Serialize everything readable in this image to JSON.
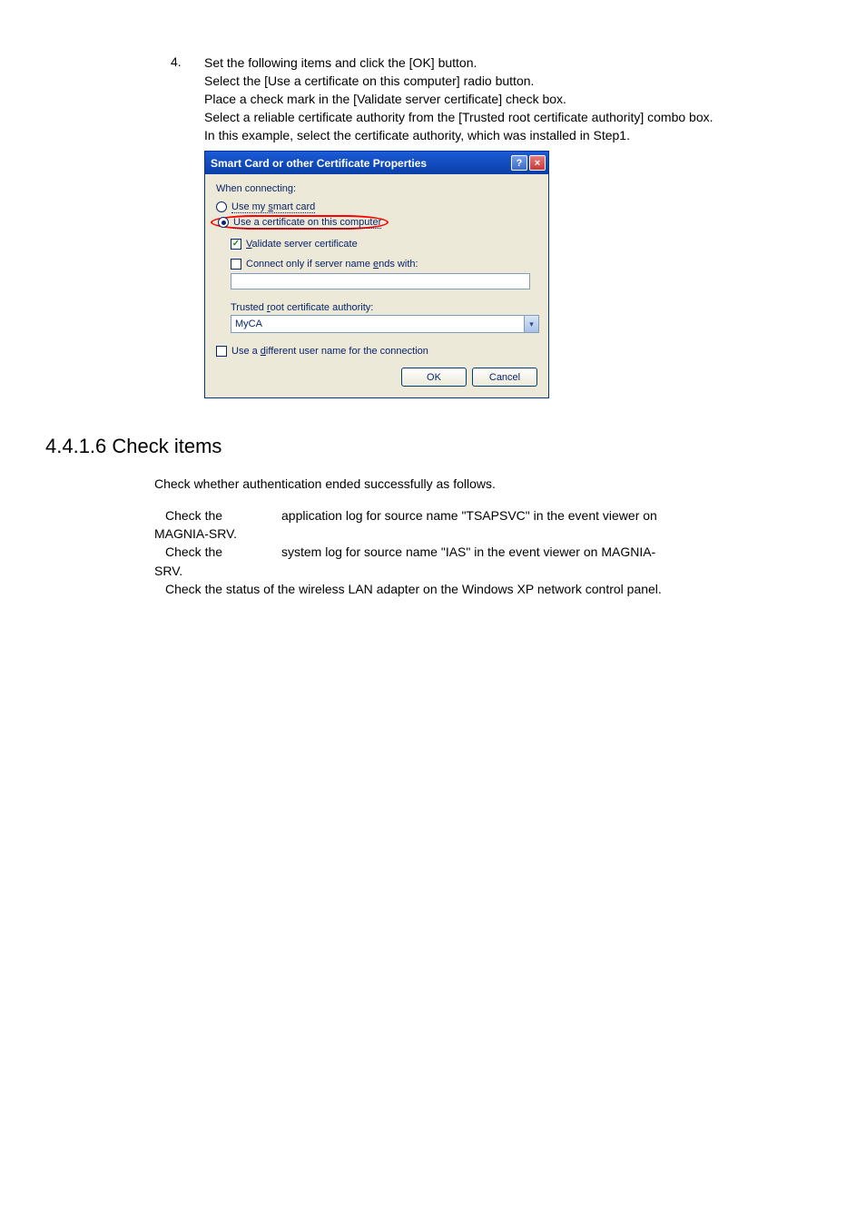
{
  "step": {
    "number": "4.",
    "lines": [
      "Set the following items and click the [OK] button.",
      "Select the [Use a certificate on this computer] radio button.",
      "Place a check mark in the [Validate server certificate] check box.",
      "Select a reliable certificate authority from the [Trusted root certificate authority] combo box.",
      "In this example, select the certificate authority, which was installed in Step1."
    ]
  },
  "dialog": {
    "title": "Smart Card or other Certificate Properties",
    "help_glyph": "?",
    "close_glyph": "×",
    "when_connecting": "When connecting:",
    "radio_smart_prefix": "Use my ",
    "radio_smart_underlined": "s",
    "radio_smart_suffix": "mart card",
    "radio_cert_full": "Use a certificate on this computer",
    "validate_underlined": "V",
    "validate_suffix": "alidate server certificate",
    "connect_only_prefix": "Connect only if server name ",
    "connect_only_underlined": "e",
    "connect_only_suffix": "nds with:",
    "trusted_prefix": "Trusted ",
    "trusted_underlined": "r",
    "trusted_suffix": "oot certificate authority:",
    "combo_value": "MyCA",
    "combo_arrow": "▾",
    "diff_prefix": "Use a ",
    "diff_underlined": "d",
    "diff_suffix": "ifferent user name for the connection",
    "ok": "OK",
    "cancel": "Cancel",
    "check_glyph": "✓"
  },
  "section": {
    "heading": "4.4.1.6 Check items",
    "intro": "Check whether authentication ended successfully as follows.",
    "item1a": "Check the",
    "item1b": "application log for source name \"TSAPSVC\" in the event viewer on",
    "item1c": "MAGNIA-SRV.",
    "item2a": "Check the",
    "item2b": "system log for source name \"IAS\" in the event viewer on MAGNIA-",
    "item2c": "SRV.",
    "item3": "Check the status of the wireless LAN adapter on the Windows XP network control panel."
  }
}
